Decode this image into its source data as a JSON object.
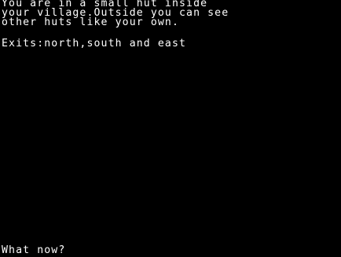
{
  "description_lines": [
    "You are in a small hut inside",
    "your village.Outside you can see",
    "other huts like your own."
  ],
  "exits_text": "Exits:north,south and east",
  "prompt_text": "What now?",
  "colors": {
    "background": "#000000",
    "text": "#ffffff"
  }
}
